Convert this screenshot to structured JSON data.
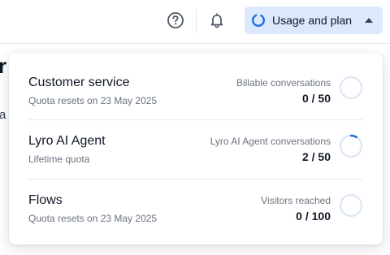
{
  "header": {
    "help_icon": "question-circle-icon",
    "bell_icon": "bell-icon",
    "plan_button_label": "Usage and plan"
  },
  "background": {
    "heading_fragment": "r",
    "text_fragment": "a"
  },
  "usage": {
    "items": [
      {
        "title": "Customer service",
        "subtitle": "Quota resets on 23 May 2025",
        "metric_label": "Billable conversations",
        "value_text": "0 / 50",
        "used": 0,
        "limit": 50
      },
      {
        "title": "Lyro AI Agent",
        "subtitle": "Lifetime quota",
        "metric_label": "Lyro AI Agent conversations",
        "value_text": "2 / 50",
        "used": 2,
        "limit": 50
      },
      {
        "title": "Flows",
        "subtitle": "Quota resets on 23 May 2025",
        "metric_label": "Visitors reached",
        "value_text": "0 / 100",
        "used": 0,
        "limit": 100
      }
    ]
  },
  "colors": {
    "accent": "#1f6fe5",
    "ring_track": "#dbe6f7",
    "plan_button_bg": "#dce8fb"
  }
}
